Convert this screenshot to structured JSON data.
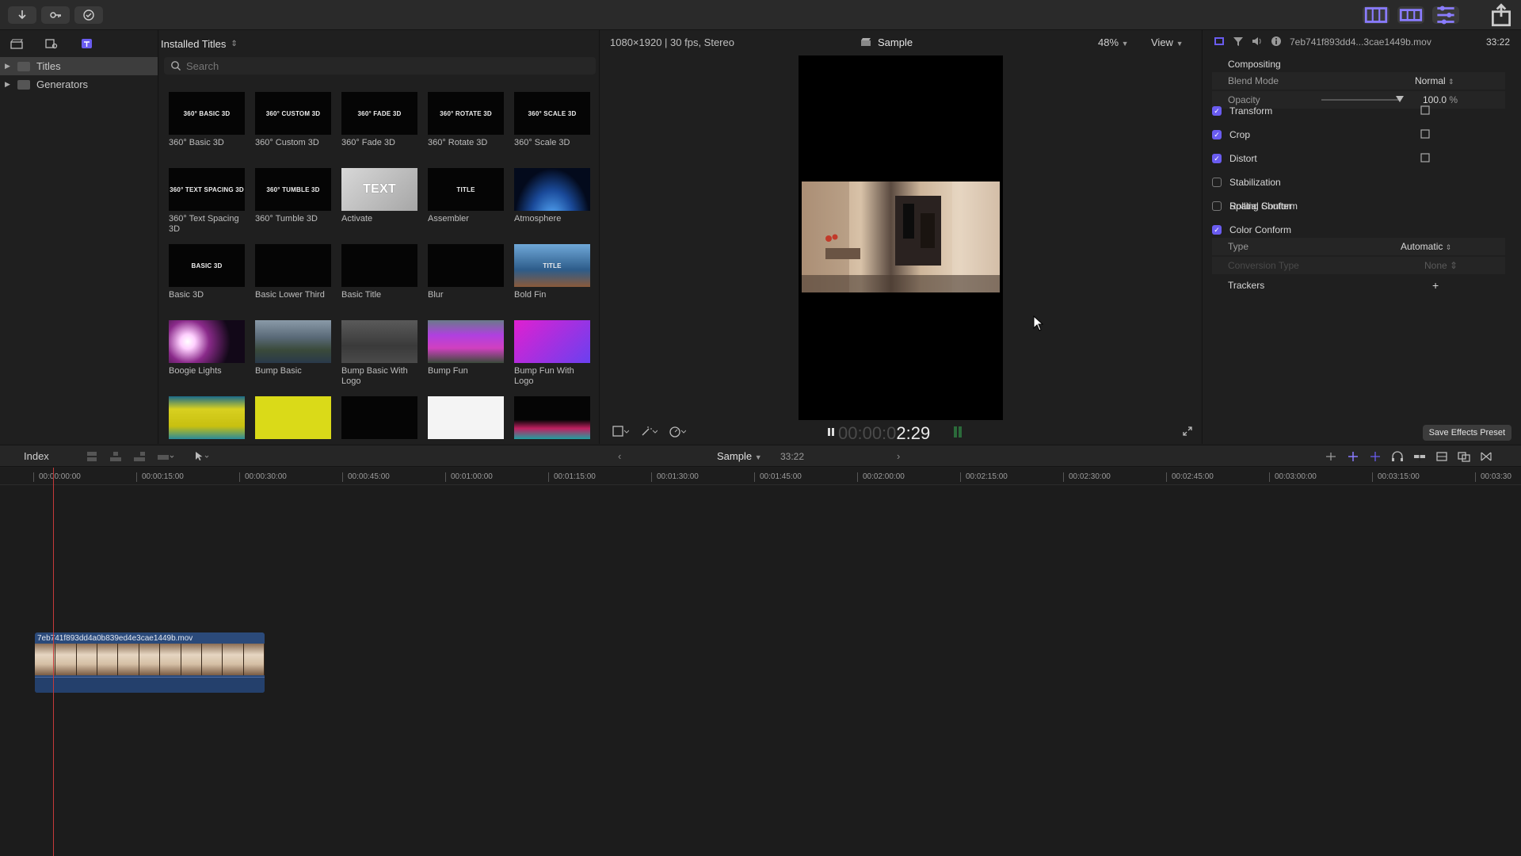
{
  "browser": {
    "title": "Installed Titles",
    "search_placeholder": "Search",
    "sidebar": [
      {
        "label": "Titles",
        "selected": true
      },
      {
        "label": "Generators",
        "selected": false
      }
    ],
    "tiles": [
      {
        "label": "360° Basic 3D",
        "thumb_text": "360° BASIC 3D"
      },
      {
        "label": "360° Custom 3D",
        "thumb_text": "360° CUSTOM 3D"
      },
      {
        "label": "360° Fade 3D",
        "thumb_text": "360° FADE 3D"
      },
      {
        "label": "360° Rotate 3D",
        "thumb_text": "360° ROTATE 3D"
      },
      {
        "label": "360° Scale 3D",
        "thumb_text": "360° SCALE 3D"
      },
      {
        "label": "360° Text Spacing 3D",
        "thumb_text": "360° TEXT SPACING 3D"
      },
      {
        "label": "360° Tumble 3D",
        "thumb_text": "360° TUMBLE 3D"
      },
      {
        "label": "Activate",
        "thumb_text": "TEXT"
      },
      {
        "label": "Assembler",
        "thumb_text": "TITLE"
      },
      {
        "label": "Atmosphere",
        "thumb_text": ""
      },
      {
        "label": "Basic 3D",
        "thumb_text": "BASIC 3D"
      },
      {
        "label": "Basic Lower Third",
        "thumb_text": ""
      },
      {
        "label": "Basic Title",
        "thumb_text": ""
      },
      {
        "label": "Blur",
        "thumb_text": ""
      },
      {
        "label": "Bold Fin",
        "thumb_text": "TITLE"
      },
      {
        "label": "Boogie Lights",
        "thumb_text": ""
      },
      {
        "label": "Bump Basic",
        "thumb_text": ""
      },
      {
        "label": "Bump Basic With Logo",
        "thumb_text": ""
      },
      {
        "label": "Bump Fun",
        "thumb_text": ""
      },
      {
        "label": "Bump Fun With Logo",
        "thumb_text": ""
      },
      {
        "label": "",
        "thumb_text": ""
      },
      {
        "label": "",
        "thumb_text": ""
      },
      {
        "label": "",
        "thumb_text": ""
      },
      {
        "label": "",
        "thumb_text": ""
      },
      {
        "label": "",
        "thumb_text": ""
      }
    ]
  },
  "viewer": {
    "info": "1080×1920 | 30 fps, Stereo",
    "title": "Sample",
    "zoom": "48%",
    "view_label": "View",
    "timecode_dim": "00:00:0",
    "timecode_bright": "2:29"
  },
  "inspector": {
    "filename": "7eb741f893dd4...3cae1449b.mov",
    "duration": "33:22",
    "compositing": "Compositing",
    "blend_mode_label": "Blend Mode",
    "blend_mode_value": "Normal",
    "opacity_label": "Opacity",
    "opacity_value": "100.0",
    "opacity_unit": "%",
    "rows": [
      {
        "label": "Transform",
        "checked": true
      },
      {
        "label": "Crop",
        "checked": true
      },
      {
        "label": "Distort",
        "checked": true
      },
      {
        "label": "Stabilization",
        "checked": false
      },
      {
        "label": "Rolling Shutter",
        "checked": false
      },
      {
        "label": "Spatial Conform",
        "checked": null
      },
      {
        "label": "Color Conform",
        "checked": true
      }
    ],
    "type_label": "Type",
    "type_value": "Automatic",
    "conversion_label": "Conversion Type",
    "conversion_value": "None",
    "trackers_label": "Trackers",
    "save_preset": "Save Effects Preset"
  },
  "timeline": {
    "index_label": "Index",
    "project": "Sample",
    "duration": "33:22",
    "ruler": [
      "00:00:00:00",
      "00:00:15:00",
      "00:00:30:00",
      "00:00:45:00",
      "00:01:00:00",
      "00:01:15:00",
      "00:01:30:00",
      "00:01:45:00",
      "00:02:00:00",
      "00:02:15:00",
      "00:02:30:00",
      "00:02:45:00",
      "00:03:00:00",
      "00:03:15:00",
      "00:03:30"
    ],
    "clip_name": "7eb741f893dd4a0b839ed4e3cae1449b.mov"
  }
}
